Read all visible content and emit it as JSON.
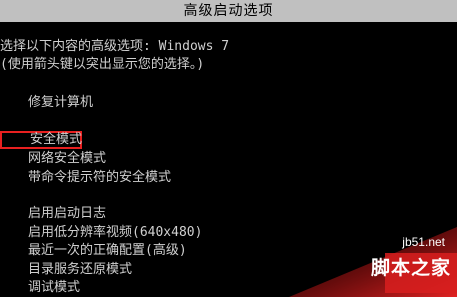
{
  "window": {
    "title": "高级启动选项"
  },
  "intro": {
    "line1": "选择以下内容的高级选项: Windows 7",
    "line2": "(使用箭头键以突出显示您的选择。)"
  },
  "menu": {
    "repair": "修复计算机",
    "items": [
      "安全模式",
      "网络安全模式",
      "带命令提示符的安全模式",
      "启用启动日志",
      "启用低分辨率视频(640x480)",
      "最近一次的正确配置(高级)",
      "目录服务还原模式",
      "调试模式"
    ],
    "selected": "安全模式"
  },
  "watermark": {
    "url": "jb51.net",
    "text": "脚本之家"
  },
  "colors": {
    "background": "#000000",
    "title_bar": "#c0c0c0",
    "text": "#d0d0d0",
    "selection_border": "#e82020",
    "watermark_red": "#d81e1e"
  }
}
